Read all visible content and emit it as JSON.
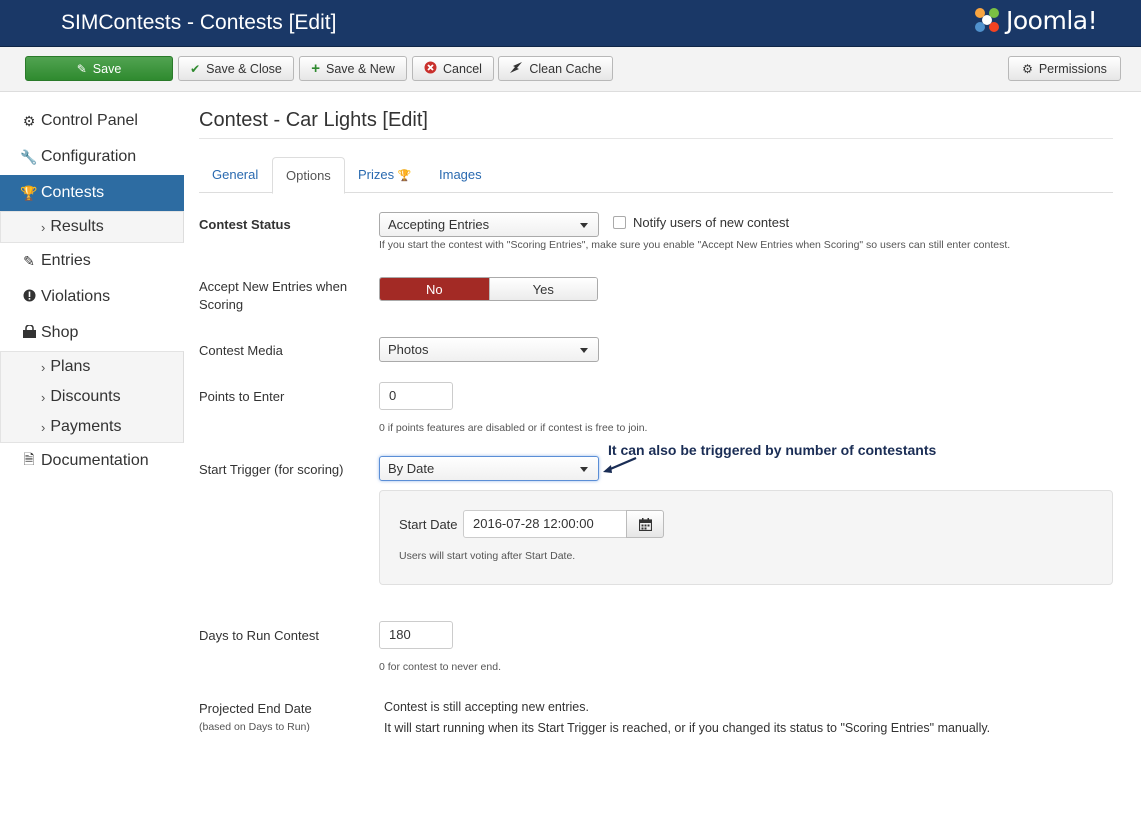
{
  "header": {
    "title": "SIMContests - Contests [Edit]",
    "brand": "Joomla!"
  },
  "toolbar": {
    "save": "Save",
    "save_close": "Save & Close",
    "save_new": "Save & New",
    "cancel": "Cancel",
    "clean_cache": "Clean Cache",
    "permissions": "Permissions"
  },
  "sidebar": {
    "items": [
      {
        "label": "Control Panel",
        "icon": "cogs-icon"
      },
      {
        "label": "Configuration",
        "icon": "wrench-icon"
      },
      {
        "label": "Contests",
        "icon": "trophy-icon",
        "active": true
      },
      {
        "label": "Results",
        "sub": true
      },
      {
        "label": "Entries",
        "icon": "edit-icon"
      },
      {
        "label": "Violations",
        "icon": "warning-icon"
      },
      {
        "label": "Shop",
        "icon": "shopping-bag-icon"
      },
      {
        "label": "Plans",
        "sub": true
      },
      {
        "label": "Discounts",
        "sub": true
      },
      {
        "label": "Payments",
        "sub": true
      },
      {
        "label": "Documentation",
        "icon": "document-icon"
      }
    ]
  },
  "main": {
    "heading": "Contest - Car Lights [Edit]",
    "tabs": [
      "General",
      "Options",
      "Prizes",
      "Images"
    ],
    "active_tab": "Options",
    "contest_status": {
      "label": "Contest Status",
      "value": "Accepting Entries",
      "notify_label": "Notify users of new contest",
      "help": "If you start the contest with \"Scoring Entries\", make sure you enable \"Accept New Entries when Scoring\" so users can still enter contest."
    },
    "accept_new": {
      "label": "Accept New Entries when Scoring",
      "no": "No",
      "yes": "Yes",
      "selected": "No"
    },
    "contest_media": {
      "label": "Contest Media",
      "value": "Photos"
    },
    "points": {
      "label": "Points to Enter",
      "value": "0",
      "help": "0 if points features are disabled or if contest is free to join."
    },
    "start_trigger": {
      "label": "Start Trigger (for scoring)",
      "value": "By Date",
      "annotation": "It can also be triggered by number of contestants"
    },
    "start_date": {
      "label": "Start Date",
      "value": "2016-07-28 12:00:00",
      "help": "Users will start voting after Start Date."
    },
    "days_to_run": {
      "label": "Days to Run Contest",
      "value": "180",
      "help": "0 for contest to never end."
    },
    "projected_end": {
      "label": "Projected End Date",
      "sublabel": "(based on Days to Run)",
      "line1": "Contest is still accepting new entries.",
      "line2": "It will start running when its Start Trigger is reached, or if you changed its status to \"Scoring Entries\" manually."
    }
  },
  "colors": {
    "header_bg": "#1a3867",
    "sidebar_active": "#2d6ca2",
    "save_green": "#3d9b3d",
    "toggle_no": "#a32a25",
    "link_blue": "#2a6ab0"
  }
}
